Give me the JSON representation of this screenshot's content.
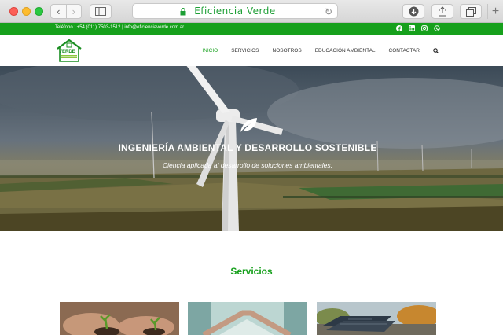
{
  "browser": {
    "url": "Eficiencia Verde"
  },
  "topbar": {
    "contact": "Teléfono : +54 (011) 7503-1512 | info@eficienciaverde.com.ar",
    "social": [
      "facebook-icon",
      "linkedin-icon",
      "instagram-icon",
      "whatsapp-icon"
    ]
  },
  "header": {
    "logo_text": "VERDE",
    "nav": [
      "INICIO",
      "SERVICIOS",
      "NOSOTROS",
      "EDUCACIÓN AMBIENTAL",
      "CONTACTAR"
    ],
    "active_nav": "INICIO"
  },
  "hero": {
    "title": "INGENIERÍA AMBIENTAL Y DESARROLLO SOSTENIBLE",
    "subtitle": "Ciencia aplicada al desarrollo de soluciones ambientales."
  },
  "services": {
    "title": "Servicios"
  },
  "colors": {
    "brand_green": "#16a01c",
    "address_text": "#1d9f35"
  }
}
